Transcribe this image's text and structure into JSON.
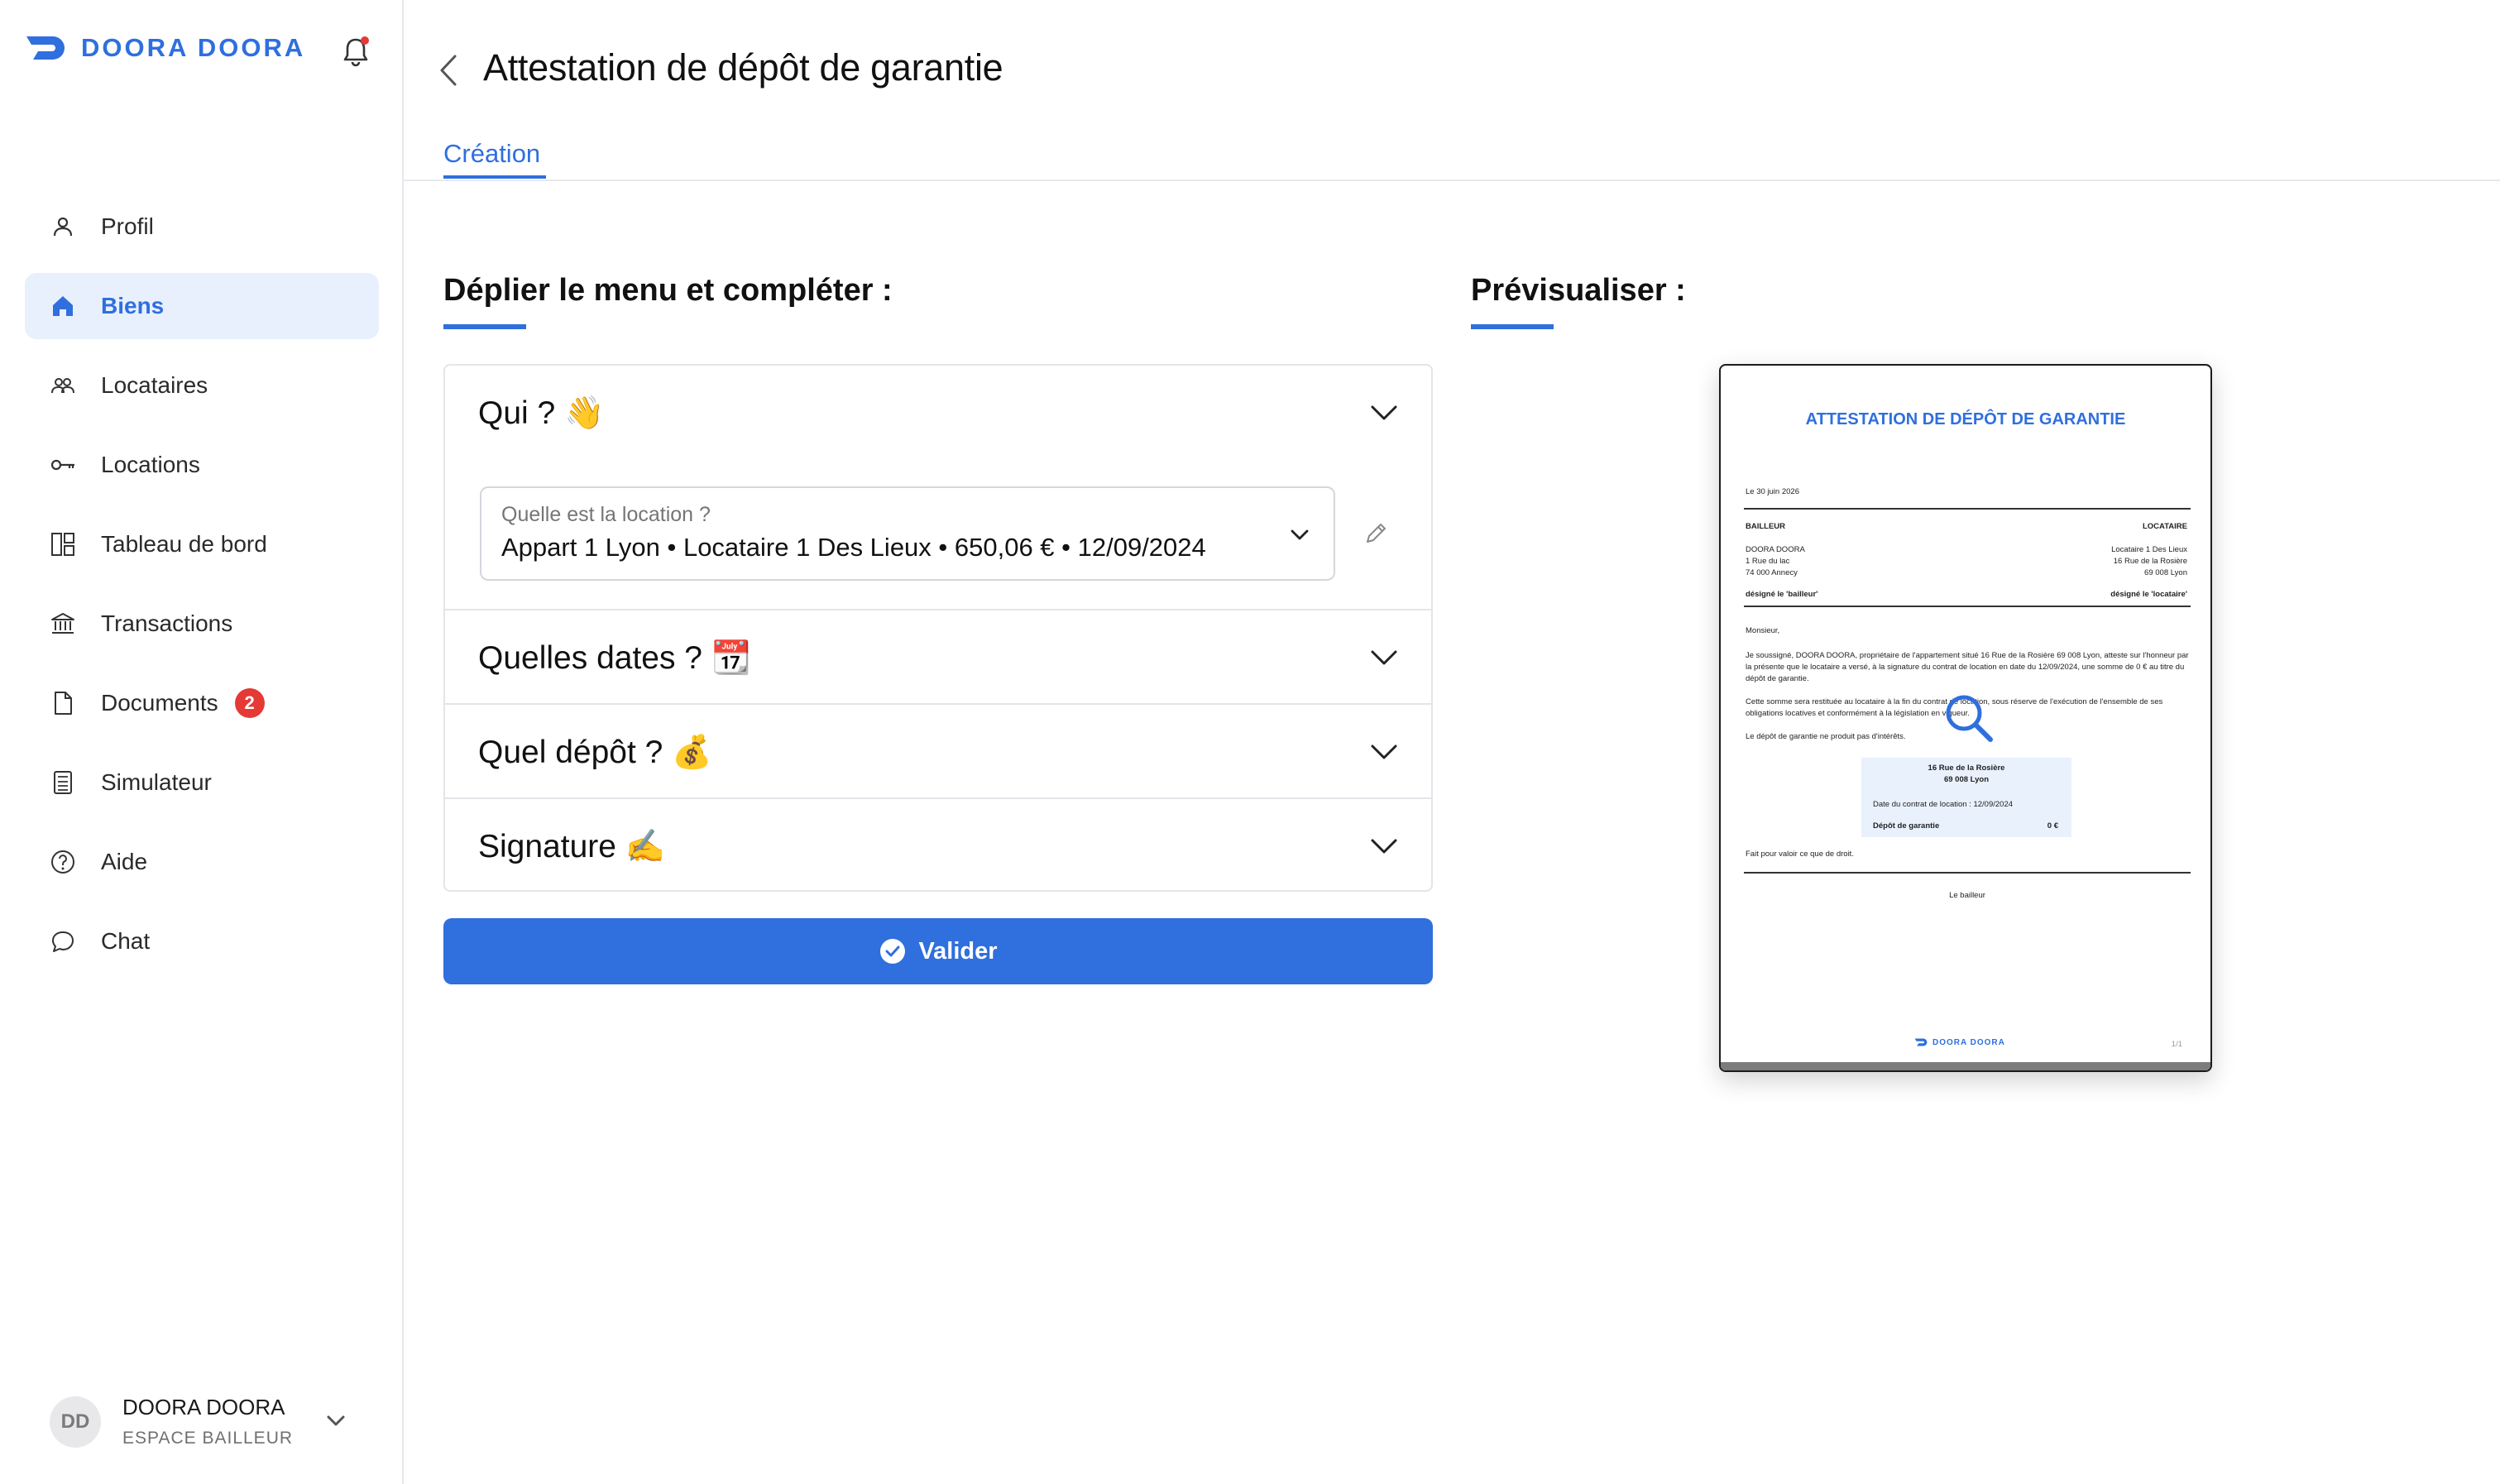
{
  "app": {
    "brand": "DOORA DOORA",
    "accent_color": "#2f6fde",
    "badge_color": "#e53935"
  },
  "sidebar": {
    "items": [
      {
        "label": "Profil",
        "icon": "user-icon",
        "active": false
      },
      {
        "label": "Biens",
        "icon": "home-icon",
        "active": true
      },
      {
        "label": "Locataires",
        "icon": "users-icon",
        "active": false
      },
      {
        "label": "Locations",
        "icon": "key-icon",
        "active": false
      },
      {
        "label": "Tableau de bord",
        "icon": "dashboard-icon",
        "active": false
      },
      {
        "label": "Transactions",
        "icon": "bank-icon",
        "active": false
      },
      {
        "label": "Documents",
        "icon": "document-icon",
        "active": false,
        "badge": "2"
      },
      {
        "label": "Simulateur",
        "icon": "calculator-icon",
        "active": false
      },
      {
        "label": "Aide",
        "icon": "help-icon",
        "active": false
      },
      {
        "label": "Chat",
        "icon": "chat-icon",
        "active": false
      }
    ],
    "user": {
      "initials": "DD",
      "name": "DOORA DOORA",
      "role": "ESPACE BAILLEUR"
    }
  },
  "header": {
    "title": "Attestation de dépôt de garantie",
    "tabs": [
      {
        "label": "Création"
      }
    ]
  },
  "form": {
    "heading": "Déplier le menu et compléter :",
    "sections": [
      {
        "title": "Qui ? 👋"
      },
      {
        "title": "Quelles dates ? 📆"
      },
      {
        "title": "Quel dépôt ? 💰"
      },
      {
        "title": "Signature ✍️"
      }
    ],
    "location_select": {
      "label": "Quelle est la location ?",
      "value": "Appart 1 Lyon • Locataire 1 Des Lieux • 650,06 € • 12/09/2024"
    },
    "submit_label": "Valider"
  },
  "preview": {
    "heading": "Prévisualiser :",
    "doc": {
      "title": "ATTESTATION DE DÉPÔT DE GARANTIE",
      "date_line": "Le 30 juin 2026",
      "landlord_heading": "BAILLEUR",
      "tenant_heading": "LOCATAIRE",
      "landlord_lines": [
        "DOORA DOORA",
        "1 Rue du lac",
        "74 000 Annecy"
      ],
      "tenant_lines": [
        "Locataire 1 Des Lieux",
        "16 Rue de la Rosière",
        "69 008 Lyon"
      ],
      "landlord_designation": "désigné le 'bailleur'",
      "tenant_designation": "désigné le 'locataire'",
      "salutation": "Monsieur,",
      "para1": "Je soussigné, DOORA DOORA, propriétaire de l'appartement situé 16 Rue de la Rosière 69 008 Lyon, atteste sur l'honneur par la présente que le locataire a versé, à la signature du contrat de location en date du 12/09/2024, une somme de 0 € au titre du dépôt de garantie.",
      "para2": "Cette somme sera restituée au locataire à la fin du contrat de location, sous réserve de l'exécution de l'ensemble de ses obligations locatives et conformément à la législation en vigueur.",
      "para3": "Le dépôt de garantie ne produit pas d'intérêts.",
      "box_address1": "16 Rue de la Rosière",
      "box_address2": "69 008 Lyon",
      "box_contract_date": "Date du contrat de location : 12/09/2024",
      "box_deposit_label": "Dépôt de garantie",
      "box_deposit_value": "0 €",
      "closing": "Fait pour valoir ce que de droit.",
      "signature_label": "Le bailleur",
      "footer_brand": "DOORA DOORA",
      "page_number": "1/1"
    }
  }
}
